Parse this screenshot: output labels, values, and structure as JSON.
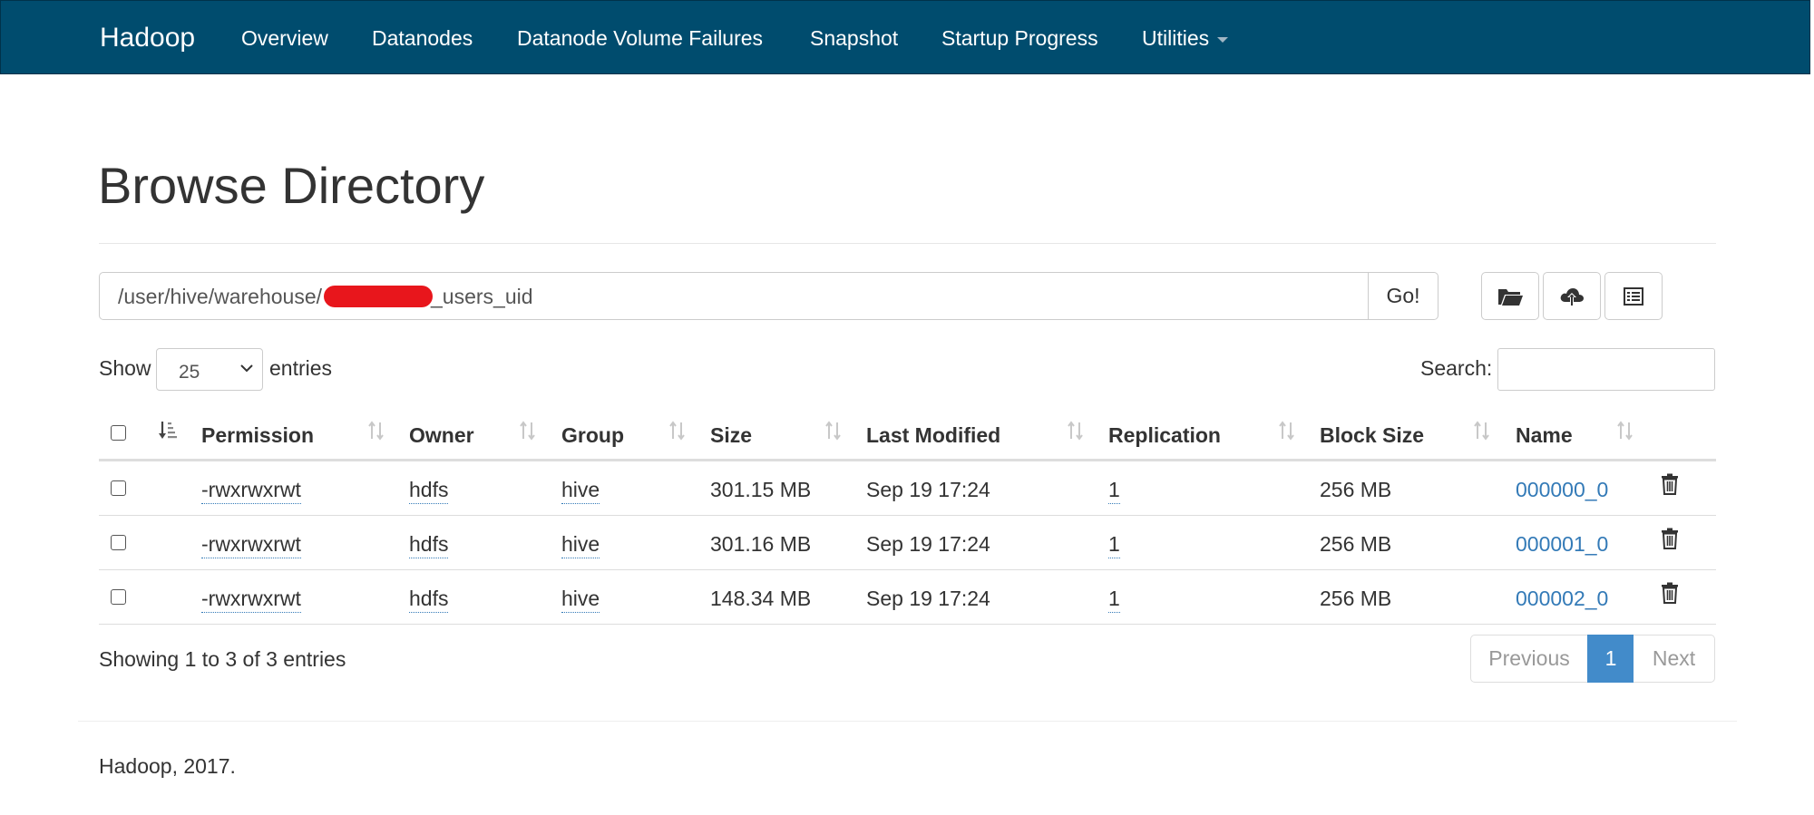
{
  "navbar": {
    "brand": "Hadoop",
    "items": [
      {
        "label": "Overview"
      },
      {
        "label": "Datanodes"
      },
      {
        "label": "Datanode Volume Failures"
      },
      {
        "label": "Snapshot"
      },
      {
        "label": "Startup Progress"
      },
      {
        "label": "Utilities",
        "dropdown": true
      }
    ]
  },
  "header": {
    "title": "Browse Directory"
  },
  "path_bar": {
    "prefix": "/user/hive/warehouse/",
    "suffix": "_users_uid",
    "redacted": true,
    "go_label": "Go!",
    "buttons": [
      {
        "icon": "folder-open-icon"
      },
      {
        "icon": "cloud-upload-icon"
      },
      {
        "icon": "list-icon"
      }
    ]
  },
  "table_controls": {
    "show_label": "Show",
    "entries_value": "25",
    "entries_label": "entries",
    "search_label": "Search:",
    "search_value": ""
  },
  "table": {
    "columns": [
      "Permission",
      "Owner",
      "Group",
      "Size",
      "Last Modified",
      "Replication",
      "Block Size",
      "Name"
    ],
    "rows": [
      {
        "permission": "-rwxrwxrwt",
        "owner": "hdfs",
        "group": "hive",
        "size": "301.15 MB",
        "last_modified": "Sep 19 17:24",
        "replication": "1",
        "block_size": "256 MB",
        "name": "000000_0"
      },
      {
        "permission": "-rwxrwxrwt",
        "owner": "hdfs",
        "group": "hive",
        "size": "301.16 MB",
        "last_modified": "Sep 19 17:24",
        "replication": "1",
        "block_size": "256 MB",
        "name": "000001_0"
      },
      {
        "permission": "-rwxrwxrwt",
        "owner": "hdfs",
        "group": "hive",
        "size": "148.34 MB",
        "last_modified": "Sep 19 17:24",
        "replication": "1",
        "block_size": "256 MB",
        "name": "000002_0"
      }
    ]
  },
  "table_footer": {
    "info": "Showing 1 to 3 of 3 entries",
    "pagination": {
      "previous": "Previous",
      "current": "1",
      "next": "Next"
    }
  },
  "footer": {
    "text": "Hadoop, 2017."
  },
  "colors": {
    "navbar_bg": "#004c6e",
    "link": "#337ab7",
    "active_page": "#428bca",
    "redaction": "#e8161c"
  }
}
